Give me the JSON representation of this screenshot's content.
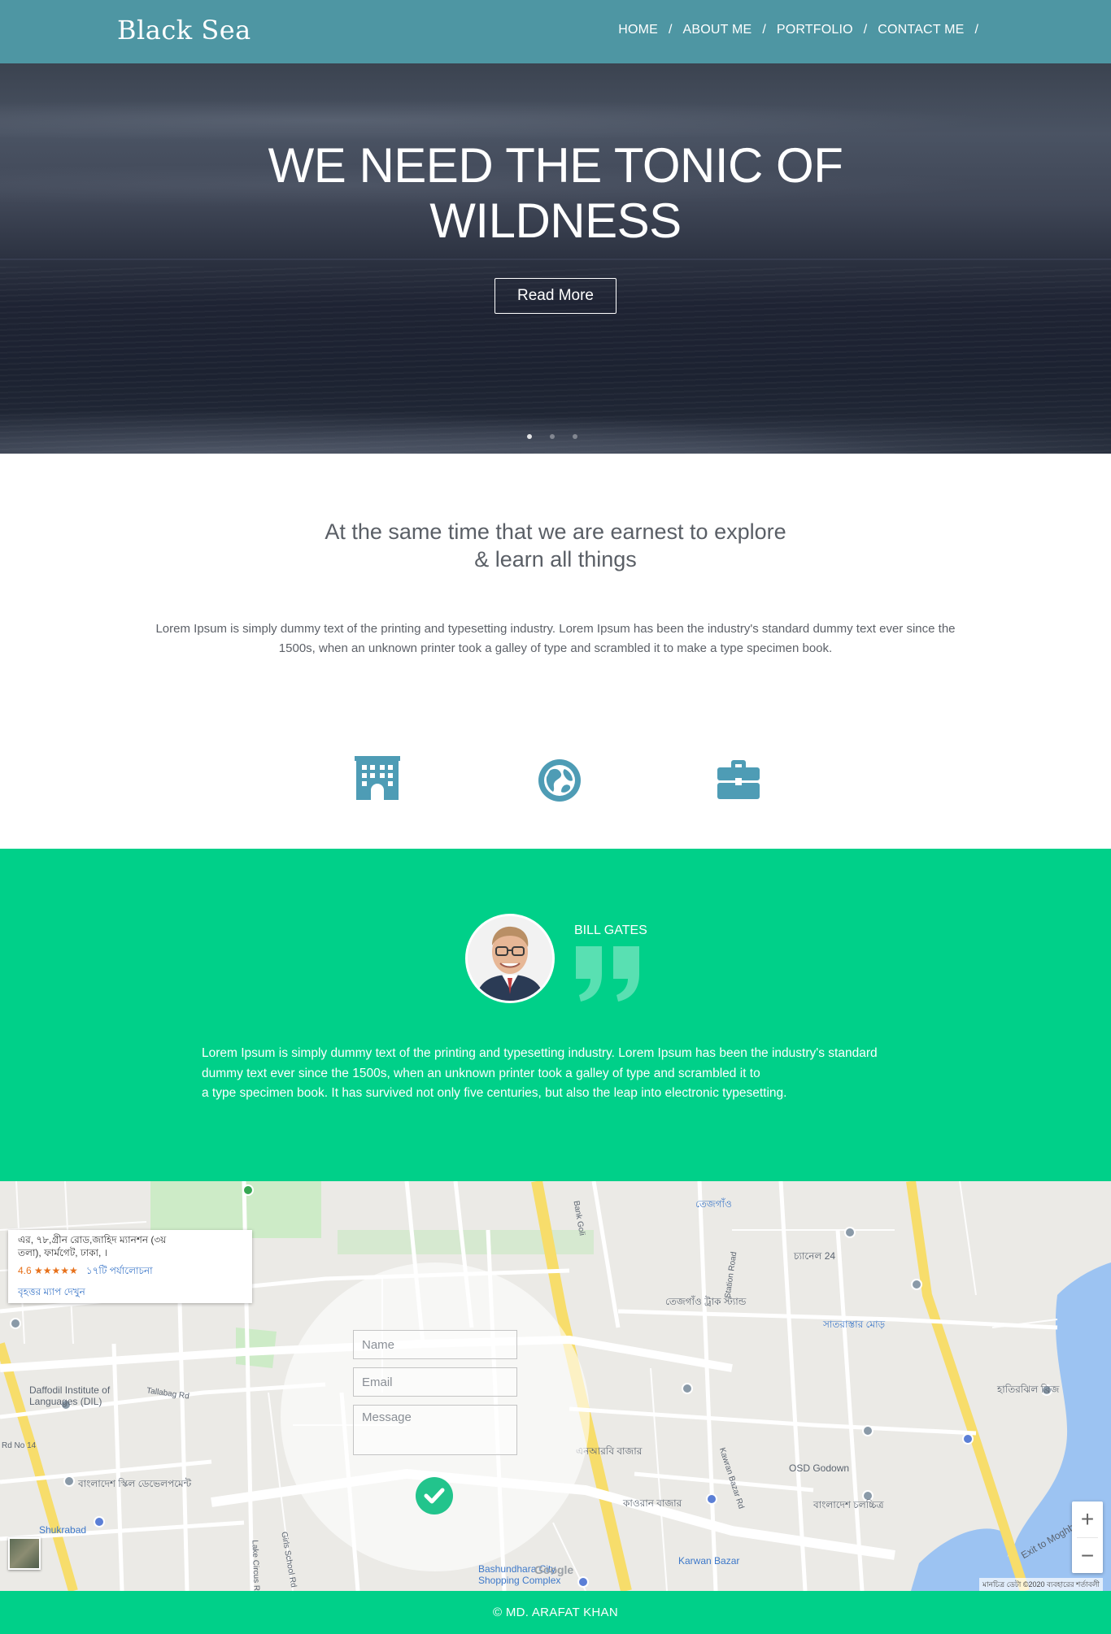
{
  "header": {
    "brand": "Black Sea",
    "nav": [
      {
        "label": "HOME"
      },
      {
        "label": "ABOUT ME"
      },
      {
        "label": "PORTFOLIO"
      },
      {
        "label": "CONTACT ME"
      }
    ],
    "separator": "/",
    "background_color": "#4e96a3"
  },
  "hero": {
    "title": "WE NEED THE TONIC OF WILDNESS",
    "button_label": "Read More",
    "slides_count": 3,
    "active_slide": 1
  },
  "about": {
    "title_line1": "At the same time that we are earnest to explore",
    "title_line2": "& learn all things",
    "body_line1": "Lorem Ipsum is simply dummy text of the printing and typesetting industry. Lorem Ipsum has been the industry's standard dummy text ever since the",
    "body_line2": "1500s, when an unknown printer took a galley of type and scrambled it to make a type specimen book.",
    "features": [
      {
        "icon": "building-icon"
      },
      {
        "icon": "globe-icon"
      },
      {
        "icon": "briefcase-icon"
      }
    ],
    "icon_color": "#4e9cb5"
  },
  "testimonial": {
    "name": "BILL GATES",
    "quote_line1": "Lorem Ipsum is simply dummy text of the printing and typesetting industry. Lorem Ipsum has been the industry's standard",
    "quote_line2": "dummy text ever since the 1500s, when an unknown printer took a galley of type and scrambled it to",
    "quote_line3": "a type specimen book. It has survived not only five centuries, but also the leap into electronic typesetting.",
    "background_color": "#00d089"
  },
  "map": {
    "info_card": {
      "address_line1": "এর, ৭৮,গ্রীন রোড,জাহিদ ম্যানশন (৩য়",
      "address_line2": "তলা), ফার্মগেট, ঢাকা, ।",
      "rating": "4.6 ★★★★★",
      "reviews": "১৭টি পর্যালোচনা",
      "larger_map": "বৃহত্তর ম্যাপ দেখুন"
    },
    "labels": {
      "daffodil": "Daffodil Institute of",
      "daffodil2": "Languages (DIL)",
      "shukrabad": "Shukrabad",
      "osd": "OSD Godown",
      "karwan": "Karwan Bazar",
      "bashundhara": "Bashundhara City",
      "bashundhara2": "Shopping Complex",
      "tejgaon": "তেজগাঁও",
      "channel24": "চ্যানেল 24",
      "satrasta": "সাতরাস্তার মোড়",
      "karwan_bn": "কাওরান বাজার",
      "enar": "এনআরবি বাজার",
      "exit": "Exit to Moghbazar",
      "tallabag": "Tallabag Rd",
      "rd14": "Rd No 14",
      "station": "Station Road",
      "kawran_rd": "Kawran Bazar Rd",
      "lake_circus": "Lake Circus Rd",
      "girls_school": "Girls School Rd",
      "bank_goli": "Bank Goli",
      "tajgaon_truck": "তেজগাঁও ট্রাক স্ট্যান্ড",
      "hatirjheel": "হাতিরঝিল ব্রিজ",
      "bd_film": "বাংলাদেশ চলচ্চিত্র",
      "bd_skill": "বাংলাদেশ স্কিল ডেভেলপমেন্ট",
      "bashundhara_bn": "Bashundhara City",
      "google": "Google",
      "map_data": "মানচিত্র ডেটা ©2020",
      "terms": "ব্যবহারের শর্তাবলী"
    },
    "zoom_in": "+",
    "zoom_out": "−"
  },
  "contact_form": {
    "name_placeholder": "Name",
    "email_placeholder": "Email",
    "message_placeholder": "Message",
    "submit_color": "#22c48c"
  },
  "footer": {
    "text": "© MD. ARAFAT KHAN",
    "background_color": "#00d089"
  }
}
